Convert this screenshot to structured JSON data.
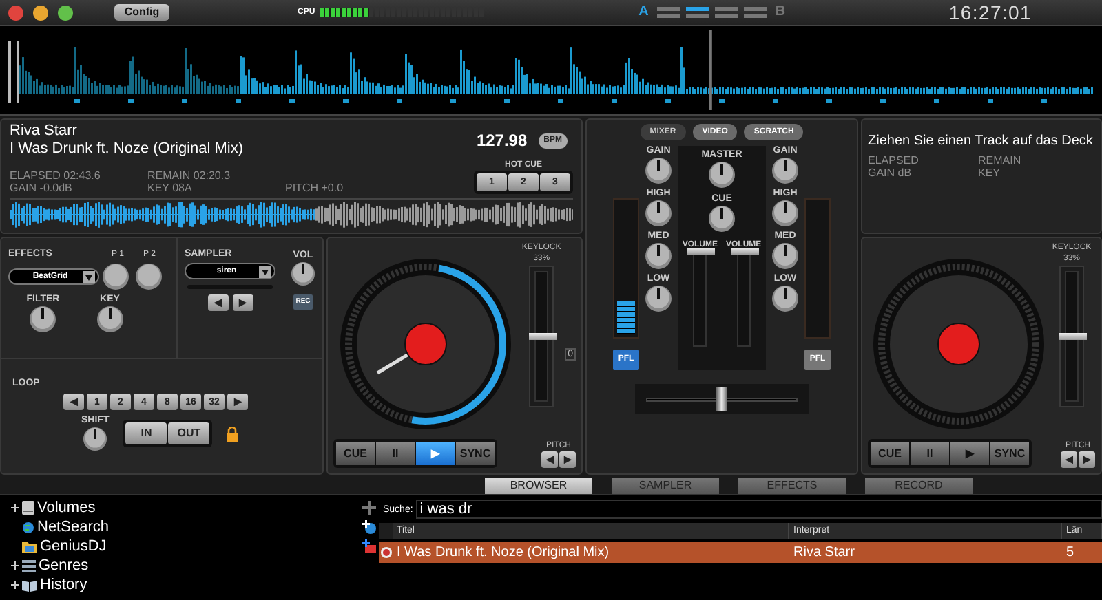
{
  "topbar": {
    "config_button": "Config",
    "cpu": {
      "label": "CPU",
      "level": 0.3
    },
    "side_a": "A",
    "side_b": "B",
    "layouts": [
      {
        "selected": false
      },
      {
        "selected": true
      },
      {
        "selected": false
      },
      {
        "selected": false
      }
    ],
    "clock": "16:27:01"
  },
  "overview": {
    "level": 0.655
  },
  "deck_left": {
    "artist": "Riva Starr",
    "title": "I Was Drunk ft. Noze (Original Mix)",
    "bpm": "127.98",
    "bpm_badge": "BPM",
    "elapsed": "ELAPSED 02:43.6",
    "gain": "GAIN -0.0dB",
    "remain": "REMAIN 02:20.3",
    "key": "KEY 08A",
    "pitch": "PITCH +0.0",
    "hot_cue_label": "HOT CUE",
    "hot_cues": [
      "1",
      "2",
      "3"
    ],
    "waveform": {
      "level": 0.54
    },
    "effects": {
      "label": "EFFECTS",
      "effect": "BeatGrid",
      "p1": "P 1",
      "p2": "P 2",
      "filter": "FILTER",
      "key": "KEY"
    },
    "sampler": {
      "label": "SAMPLER",
      "sample": "siren",
      "vol": "VOL",
      "rec": "REC"
    },
    "loop": {
      "label": "LOOP",
      "prev": "◀",
      "sizes": [
        "1",
        "2",
        "4",
        "8",
        "16",
        "32"
      ],
      "next": "▶",
      "shift": "SHIFT",
      "in": "IN",
      "out": "OUT"
    },
    "keylock": "KEYLOCK",
    "pitch_range": "33%",
    "pitch_slider": {
      "level": 0.5
    },
    "zero": "0",
    "platter": {
      "level": 0.5
    },
    "pitch_label": "PITCH",
    "pitch_buttons": [
      "◀",
      "▶"
    ],
    "transport": [
      {
        "label": "CUE",
        "selected": false
      },
      {
        "label": "II",
        "selected": false
      },
      {
        "label": "▶",
        "selected": true
      },
      {
        "label": "SYNC",
        "selected": false
      }
    ]
  },
  "mixer": {
    "tabs": [
      {
        "label": "MIXER",
        "selected": true
      },
      {
        "label": "VIDEO",
        "selected": false
      },
      {
        "label": "SCRATCH",
        "selected": false
      }
    ],
    "left": {
      "knobs": [
        "GAIN",
        "HIGH",
        "MED",
        "LOW"
      ],
      "vu": {
        "level": 0.25
      },
      "pfl": {
        "label": "PFL",
        "selected": true
      }
    },
    "right": {
      "knobs": [
        "GAIN",
        "HIGH",
        "MED",
        "LOW"
      ],
      "pfl": {
        "label": "PFL",
        "selected": false
      }
    },
    "master": "MASTER",
    "cue": "CUE",
    "volumes": [
      {
        "label": "VOLUME",
        "level": 1
      },
      {
        "label": "VOLUME",
        "level": 1
      }
    ],
    "crossfader": {
      "level": 0.5
    }
  },
  "deck_right": {
    "message": "Ziehen Sie einen Track auf das Deck",
    "elapsed": "ELAPSED",
    "gain": "GAIN dB",
    "remain": "REMAIN",
    "key": "KEY",
    "keylock": "KEYLOCK",
    "pitch_range": "33%",
    "pitch_slider": {
      "level": 0.5
    },
    "pitch_label": "PITCH",
    "pitch_buttons": [
      "◀",
      "▶"
    ],
    "transport": [
      {
        "label": "CUE",
        "selected": false
      },
      {
        "label": "II",
        "selected": false
      },
      {
        "label": "▶",
        "selected": false
      },
      {
        "label": "SYNC",
        "selected": false
      }
    ]
  },
  "browser_tabs": [
    {
      "label": "BROWSER",
      "selected": true
    },
    {
      "label": "SAMPLER",
      "selected": false
    },
    {
      "label": "EFFECTS",
      "selected": false
    },
    {
      "label": "RECORD",
      "selected": false
    }
  ],
  "sidebar": {
    "items": [
      {
        "label": "Volumes",
        "kind": "drive",
        "expandable": true
      },
      {
        "label": "NetSearch",
        "kind": "globe",
        "expandable": false
      },
      {
        "label": "GeniusDJ",
        "kind": "folder",
        "expandable": false
      },
      {
        "label": "Genres",
        "kind": "stack",
        "expandable": true
      },
      {
        "label": "History",
        "kind": "book",
        "expandable": true
      }
    ]
  },
  "search": {
    "label": "Suche:",
    "value": "i was dr"
  },
  "table": {
    "columns": [
      "Titel",
      "Interpret",
      "Län"
    ],
    "rows": [
      {
        "cells": [
          "I Was Drunk ft. Noze (Original Mix)",
          "Riva Starr",
          "5"
        ],
        "selected": true
      }
    ]
  }
}
